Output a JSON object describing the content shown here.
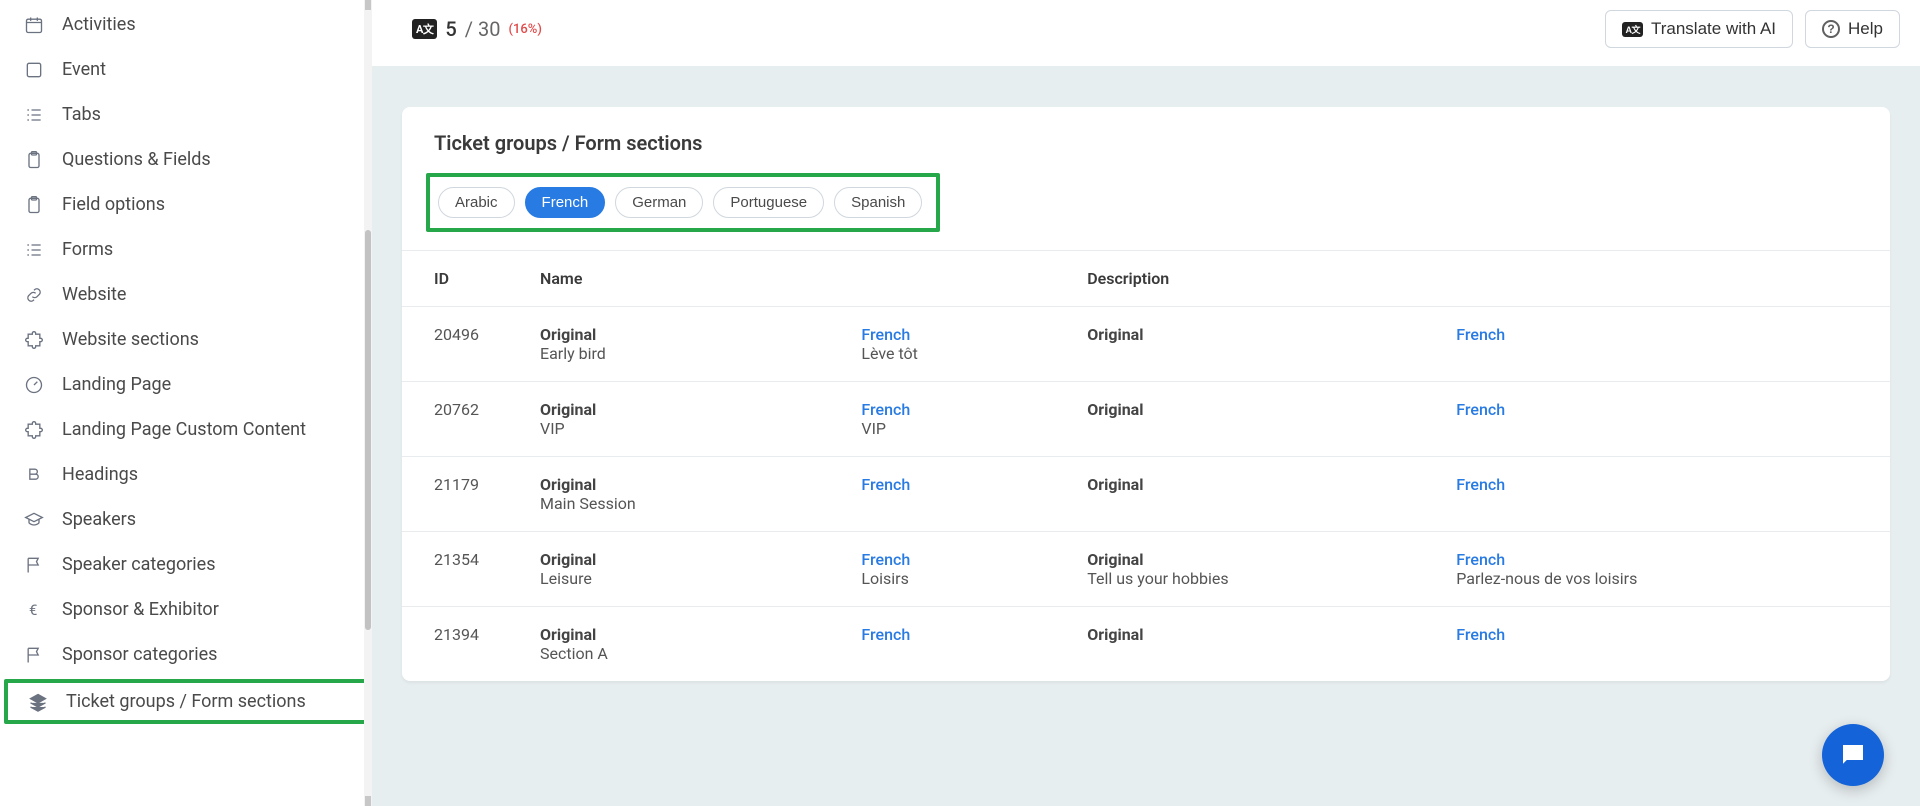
{
  "sidebar": {
    "items": [
      {
        "icon": "calendar",
        "label": "Activities"
      },
      {
        "icon": "square",
        "label": "Event"
      },
      {
        "icon": "list",
        "label": "Tabs"
      },
      {
        "icon": "clipboard",
        "label": "Questions & Fields"
      },
      {
        "icon": "clipboard",
        "label": "Field options"
      },
      {
        "icon": "list",
        "label": "Forms"
      },
      {
        "icon": "link",
        "label": "Website"
      },
      {
        "icon": "puzzle",
        "label": "Website sections"
      },
      {
        "icon": "dashboard",
        "label": "Landing Page"
      },
      {
        "icon": "puzzle",
        "label": "Landing Page Custom Content"
      },
      {
        "icon": "bold",
        "label": "Headings"
      },
      {
        "icon": "grad",
        "label": "Speakers"
      },
      {
        "icon": "flag",
        "label": "Speaker categories"
      },
      {
        "icon": "euro",
        "label": "Sponsor & Exhibitor"
      },
      {
        "icon": "flag",
        "label": "Sponsor categories"
      },
      {
        "icon": "layers",
        "label": "Ticket groups / Form sections"
      }
    ]
  },
  "topbar": {
    "count": "5",
    "total": "/ 30",
    "pct": "(16%)",
    "translate_btn": "Translate with AI",
    "help_btn": "Help"
  },
  "card": {
    "title": "Ticket groups / Form sections",
    "tabs": [
      {
        "label": "Arabic"
      },
      {
        "label": "French"
      },
      {
        "label": "German"
      },
      {
        "label": "Portuguese"
      },
      {
        "label": "Spanish"
      }
    ],
    "active_lang": "French",
    "columns": {
      "id": "ID",
      "name": "Name",
      "desc": "Description"
    },
    "lbl_original": "Original",
    "rows": [
      {
        "id": "20496",
        "name_orig": "Early bird",
        "name_tr": "Lève tôt",
        "desc_orig": "",
        "desc_tr": ""
      },
      {
        "id": "20762",
        "name_orig": "VIP",
        "name_tr": "VIP",
        "desc_orig": "",
        "desc_tr": ""
      },
      {
        "id": "21179",
        "name_orig": "Main Session",
        "name_tr": "",
        "desc_orig": "",
        "desc_tr": ""
      },
      {
        "id": "21354",
        "name_orig": "Leisure",
        "name_tr": "Loisirs",
        "desc_orig": "Tell us your hobbies",
        "desc_tr": "Parlez-nous de vos loisirs"
      },
      {
        "id": "21394",
        "name_orig": "Section A",
        "name_tr": "",
        "desc_orig": "",
        "desc_tr": ""
      }
    ]
  }
}
